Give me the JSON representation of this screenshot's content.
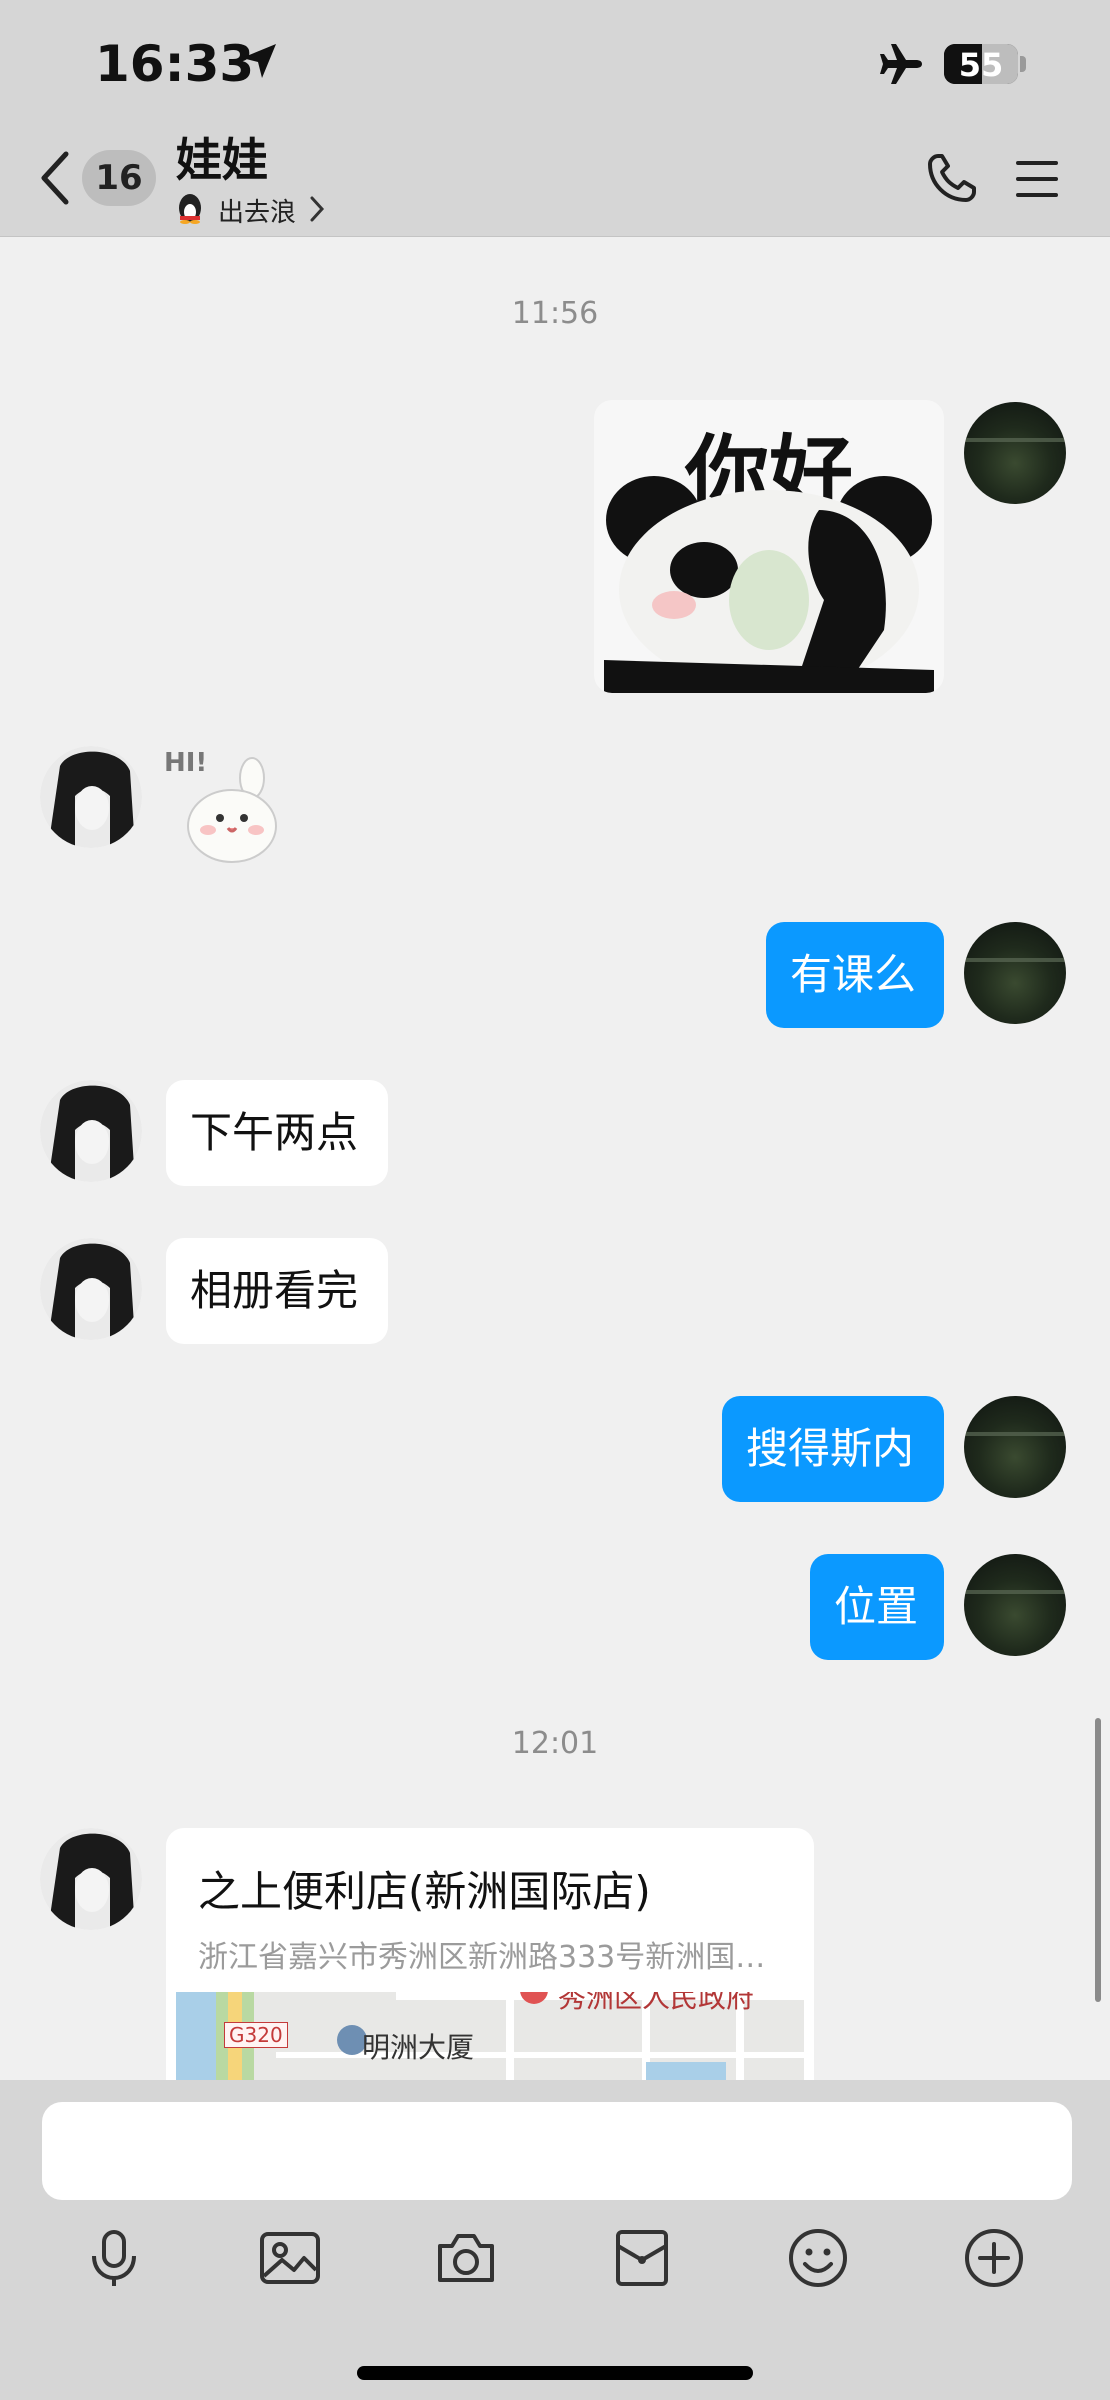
{
  "status_bar": {
    "time": "16:33",
    "battery": "55",
    "icons": [
      "location-arrow-icon",
      "airplane-icon",
      "battery-icon"
    ]
  },
  "header": {
    "unread_count": "16",
    "contact_name": "娃娃",
    "status_text": "出去浪",
    "icons": [
      "back-chevron-icon",
      "phone-icon",
      "menu-icon"
    ]
  },
  "messages": [
    {
      "type": "timestamp",
      "text": "11:56"
    },
    {
      "type": "sticker",
      "from": "me",
      "text": "你好"
    },
    {
      "type": "sticker",
      "from": "them",
      "text": "HI!"
    },
    {
      "type": "text",
      "from": "me",
      "text": "有课么"
    },
    {
      "type": "text",
      "from": "them",
      "text": "下午两点"
    },
    {
      "type": "text",
      "from": "them",
      "text": "相册看完"
    },
    {
      "type": "text",
      "from": "me",
      "text": "搜得斯内"
    },
    {
      "type": "text",
      "from": "me",
      "text": "位置"
    },
    {
      "type": "timestamp",
      "text": "12:01"
    },
    {
      "type": "location",
      "from": "them",
      "title": "之上便利店(新洲国际店)",
      "address": "浙江省嘉兴市秀洲区新洲路333号新洲国…",
      "map_labels": {
        "road": "G320",
        "building": "明洲大厦",
        "poi": "秀洲区人民政府"
      }
    }
  ],
  "input": {
    "placeholder": ""
  },
  "toolbar": [
    "microphone-icon",
    "image-icon",
    "camera-icon",
    "red-packet-icon",
    "emoji-icon",
    "plus-icon"
  ],
  "colors": {
    "accent": "#0b99ff",
    "background": "#f0f0f0",
    "bar": "#d6d6d6"
  }
}
